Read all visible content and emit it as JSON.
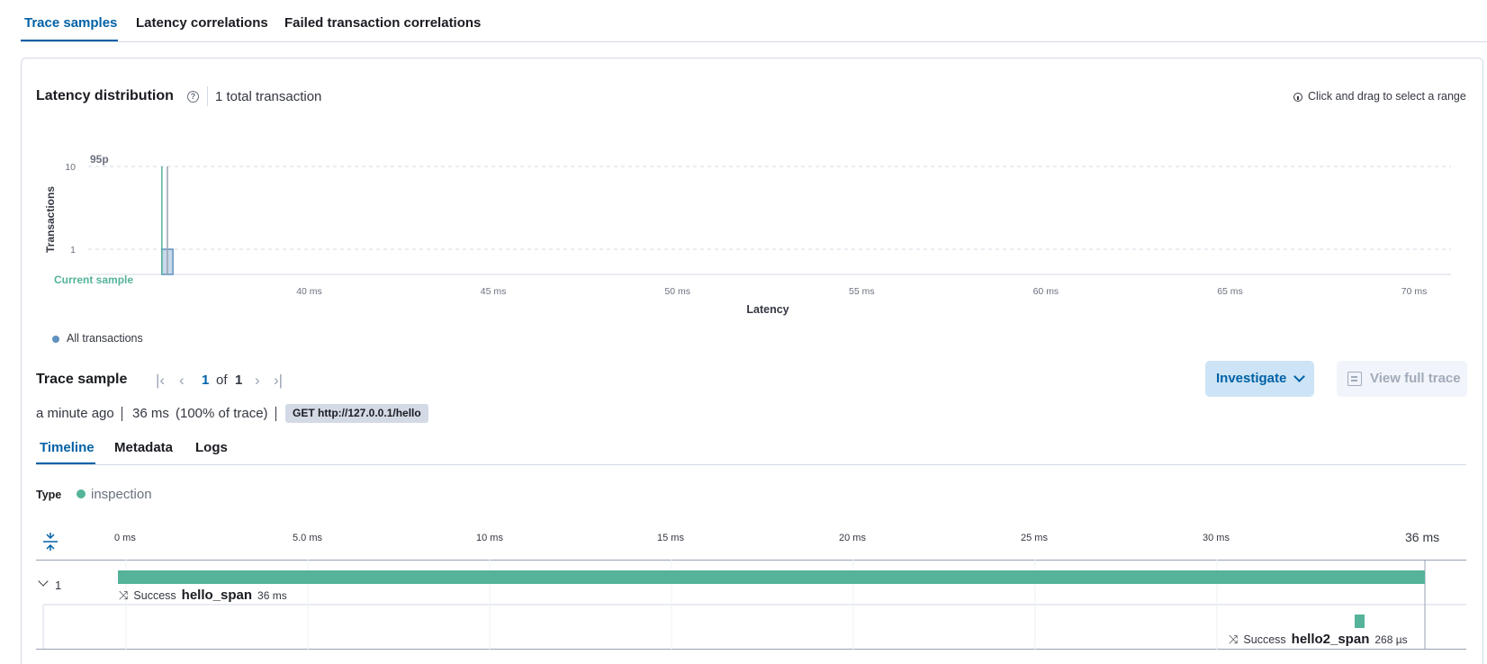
{
  "tabs": [
    {
      "label": "Trace samples",
      "active": true
    },
    {
      "label": "Latency correlations",
      "active": false
    },
    {
      "label": "Failed transaction correlations",
      "active": false
    }
  ],
  "latency": {
    "title": "Latency distribution",
    "total": "1 total transaction",
    "hint": "Click and drag to select a range",
    "legend": "All transactions",
    "current_sample": "Current sample",
    "percentile_marker": "95p"
  },
  "chart_data": {
    "type": "bar",
    "title": "",
    "xlabel": "Latency",
    "ylabel": "Transactions",
    "y_scale": "log",
    "y_ticks": [
      "1",
      "10"
    ],
    "x_ticks": [
      "40 ms",
      "45 ms",
      "50 ms",
      "55 ms",
      "60 ms",
      "65 ms",
      "70 ms"
    ],
    "xlim": [
      34,
      71
    ],
    "series": [
      {
        "name": "All transactions",
        "color": "#6092c0",
        "bins": [
          {
            "x_start": 36.0,
            "x_end": 36.3,
            "count": 1
          }
        ]
      }
    ],
    "markers": [
      {
        "label": "95p",
        "x": 36.15
      },
      {
        "label": "Current sample",
        "x": 36.0
      }
    ],
    "grid": true,
    "legend_position": "bottom-left"
  },
  "trace_sample": {
    "title": "Trace sample",
    "current_page": "1",
    "of_label": "of",
    "total_pages": "1",
    "investigate_label": "Investigate",
    "view_full_trace_label": "View full trace",
    "time_ago": "a minute ago",
    "duration": "36 ms",
    "percent_of_trace": "(100% of trace)",
    "transaction_name": "GET http://127.0.0.1/hello"
  },
  "sub_tabs": [
    {
      "label": "Timeline",
      "active": true
    },
    {
      "label": "Metadata",
      "active": false
    },
    {
      "label": "Logs",
      "active": false
    }
  ],
  "timeline": {
    "type_label": "Type",
    "type_value": "inspection",
    "type_color": "#54b399",
    "ticks": [
      "0 ms",
      "5.0 ms",
      "10 ms",
      "15 ms",
      "20 ms",
      "25 ms",
      "30 ms"
    ],
    "end_tick": "36 ms",
    "group_count": "1",
    "spans": [
      {
        "status": "Success",
        "name": "hello_span",
        "duration": "36 ms",
        "start_ms": 0,
        "duration_ms": 36
      },
      {
        "status": "Success",
        "name": "hello2_span",
        "duration": "268 µs",
        "start_ms": 34.7,
        "duration_ms": 0.268
      }
    ]
  }
}
